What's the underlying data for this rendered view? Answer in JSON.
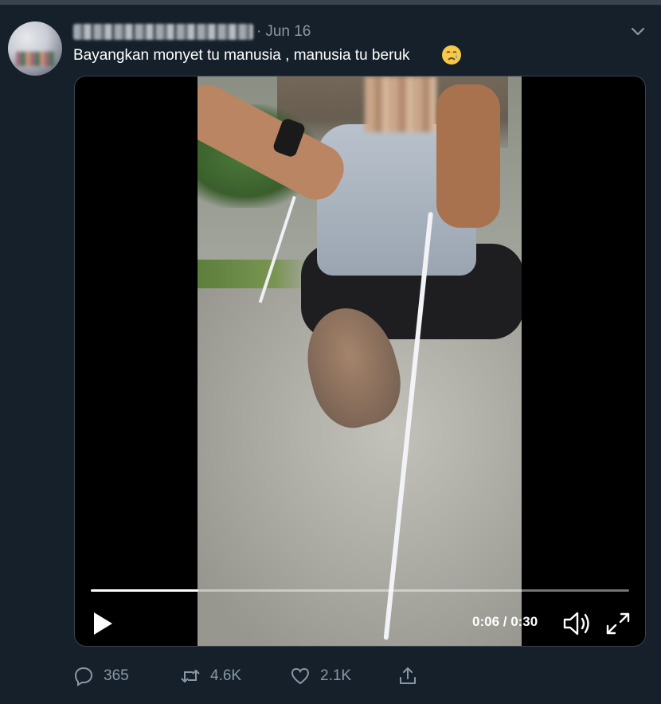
{
  "tweet": {
    "date": "Jun 16",
    "dot": "·",
    "text": "Bayangkan monyet tu manusia , manusia tu beruk"
  },
  "icons": {
    "avatar": "avatar-image",
    "caret": "chevron-down-icon",
    "emoji": "crying-face-emoji",
    "play": "play-icon",
    "volume": "volume-icon",
    "fullscreen": "fullscreen-icon",
    "reply": "reply-icon",
    "retweet": "retweet-icon",
    "like": "heart-icon",
    "share": "share-icon"
  },
  "video": {
    "current_time": "0:06",
    "duration": "0:30",
    "time_display": "0:06 / 0:30",
    "progress": 0.2
  },
  "actions": {
    "replies": "365",
    "retweets": "4.6K",
    "likes": "2.1K"
  },
  "colors": {
    "background": "#15202b",
    "secondary_text": "#8899a6",
    "border": "#38444d"
  }
}
